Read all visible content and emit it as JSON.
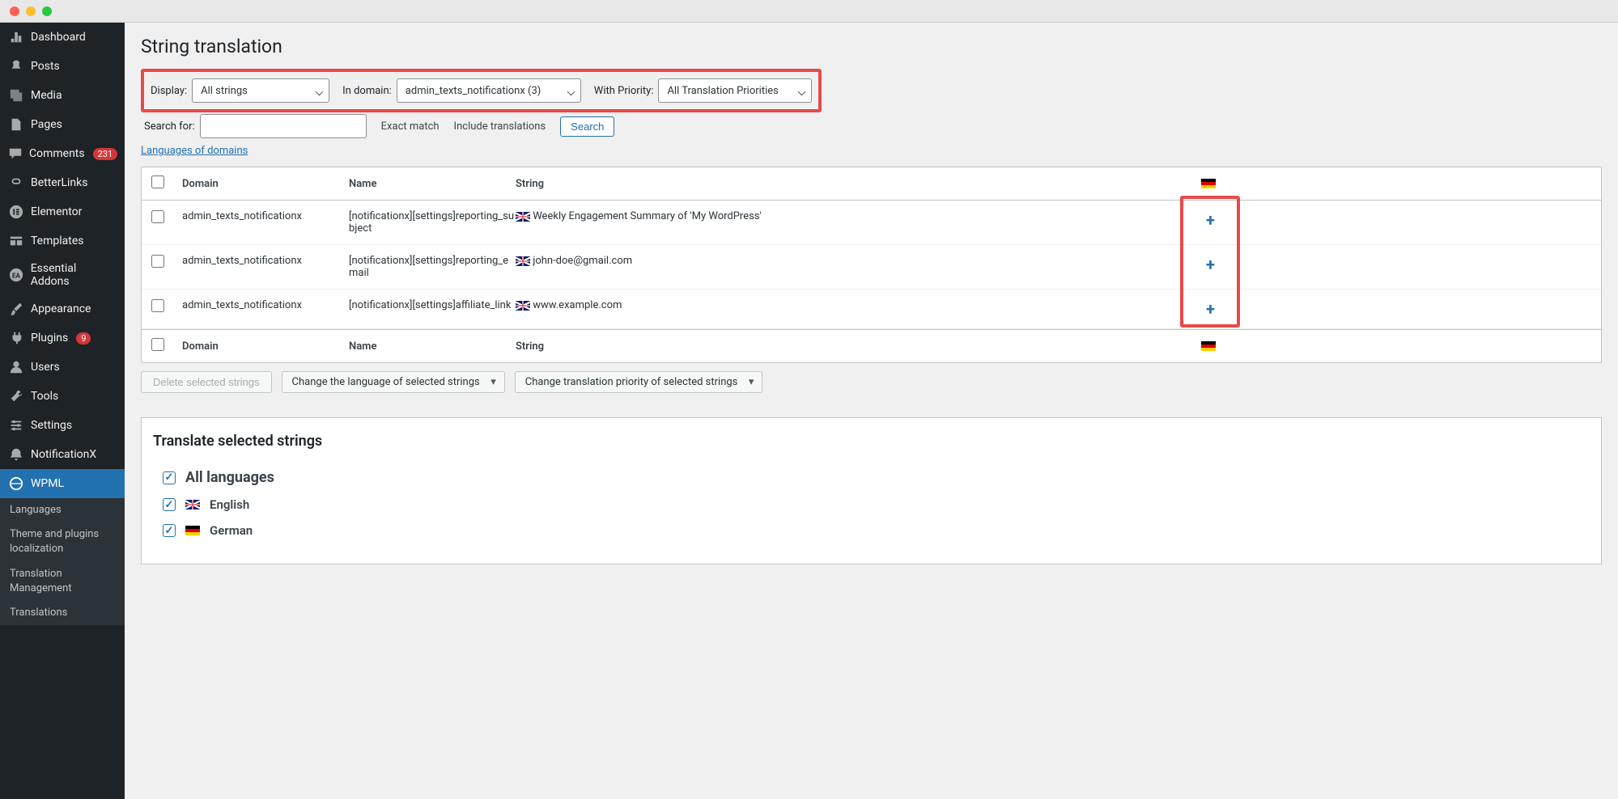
{
  "page_title": "String translation",
  "sidebar": {
    "items": [
      {
        "icon": "dashboard",
        "label": "Dashboard"
      },
      {
        "icon": "pin",
        "label": "Posts"
      },
      {
        "icon": "media",
        "label": "Media"
      },
      {
        "icon": "page",
        "label": "Pages"
      },
      {
        "icon": "comment",
        "label": "Comments",
        "badge": "231"
      },
      {
        "icon": "link",
        "label": "BetterLinks"
      },
      {
        "icon": "elementor",
        "label": "Elementor"
      },
      {
        "icon": "templates",
        "label": "Templates"
      },
      {
        "icon": "ea",
        "label": "Essential Addons"
      },
      {
        "icon": "brush",
        "label": "Appearance"
      },
      {
        "icon": "plugin",
        "label": "Plugins",
        "badge": "9"
      },
      {
        "icon": "user",
        "label": "Users"
      },
      {
        "icon": "tool",
        "label": "Tools"
      },
      {
        "icon": "settings",
        "label": "Settings"
      },
      {
        "icon": "nx",
        "label": "NotificationX"
      },
      {
        "icon": "wpml",
        "label": "WPML",
        "active": true
      }
    ],
    "submenu": [
      "Languages",
      "Theme and plugins localization",
      "Translation Management",
      "Translations"
    ]
  },
  "filters": {
    "display_label": "Display:",
    "display_value": "All strings",
    "domain_label": "In domain:",
    "domain_value": "admin_texts_notificationx (3)",
    "priority_label": "With Priority:",
    "priority_value": "All Translation Priorities"
  },
  "search": {
    "label": "Search for:",
    "exact": "Exact match",
    "include": "Include translations",
    "button": "Search"
  },
  "lang_domains_link": "Languages of domains",
  "table": {
    "headers": {
      "domain": "Domain",
      "name": "Name",
      "string": "String"
    },
    "rows": [
      {
        "domain": "admin_texts_notificationx",
        "name": "[notificationx][settings]reporting_subject",
        "string": "Weekly Engagement Summary of 'My WordPress'"
      },
      {
        "domain": "admin_texts_notificationx",
        "name": "[notificationx][settings]reporting_email",
        "string": "john-doe@gmail.com"
      },
      {
        "domain": "admin_texts_notificationx",
        "name": "[notificationx][settings]affiliate_link",
        "string": "www.example.com"
      }
    ]
  },
  "bulk": {
    "delete": "Delete selected strings",
    "change_lang": "Change the language of selected strings",
    "change_priority": "Change translation priority of selected strings"
  },
  "translate_panel": {
    "title": "Translate selected strings",
    "all": "All languages",
    "langs": [
      {
        "flag": "uk",
        "label": "English"
      },
      {
        "flag": "de",
        "label": "German"
      }
    ]
  }
}
